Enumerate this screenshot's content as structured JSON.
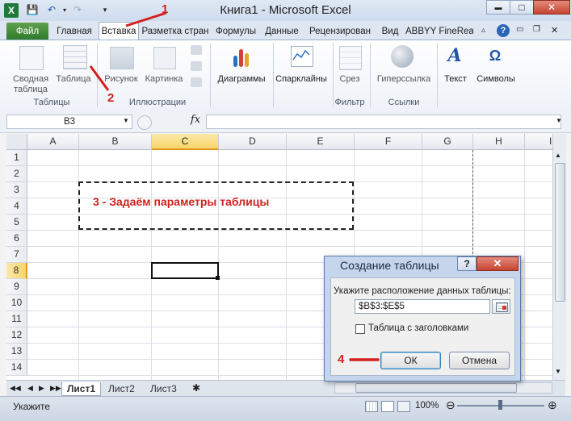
{
  "titlebar": {
    "title": "Книга1  -  Microsoft Excel",
    "minimize": "▬",
    "maximize": "□",
    "close": "✕"
  },
  "tabs": [
    "Файл",
    "Главная",
    "Вставка",
    "Разметка стран",
    "Формулы",
    "Данные",
    "Рецензирован",
    "Вид",
    "ABBYY FineRead"
  ],
  "ribbon": {
    "pivot": "Сводная\nтаблица",
    "table": "Таблица",
    "picture": "Рисунок",
    "clipart": "Картинка",
    "charts": "Диаграммы",
    "sparklines": "Спарклайны",
    "slicer": "Срез",
    "hyperlink": "Гиперссылка",
    "text": "Текст",
    "symbols": "Символы",
    "groups": [
      "Таблицы",
      "Иллюстрации",
      "Фильтр",
      "Ссылки"
    ]
  },
  "formula_bar": {
    "name_box": "B3",
    "fx": "fx",
    "value": ""
  },
  "columns": [
    "A",
    "B",
    "C",
    "D",
    "E",
    "F",
    "G",
    "H",
    "I"
  ],
  "rows": [
    "1",
    "2",
    "3",
    "4",
    "5",
    "6",
    "7",
    "8",
    "9",
    "10",
    "11",
    "12",
    "13",
    "14"
  ],
  "selected": {
    "column": "C",
    "row": "8"
  },
  "annotations": {
    "step1": "1",
    "step2": "2",
    "step3": "3 - Задаём параметры таблицы",
    "step4": "4"
  },
  "sheets": [
    "Лист1",
    "Лист2",
    "Лист3"
  ],
  "status": {
    "text": "Укажите",
    "zoom": "100%"
  },
  "dialog": {
    "title": "Создание таблицы",
    "help": "?",
    "close": "✕",
    "prompt": "Укажите расположение данных таблицы:",
    "range": "$B$3:$E$5",
    "checkbox_label": "Таблица с заголовками",
    "ok": "ОК",
    "cancel": "Отмена"
  },
  "colors": {
    "annotation": "#d41f1f",
    "selection": "#f7d56b",
    "file_tab": "#2f7b2c"
  }
}
